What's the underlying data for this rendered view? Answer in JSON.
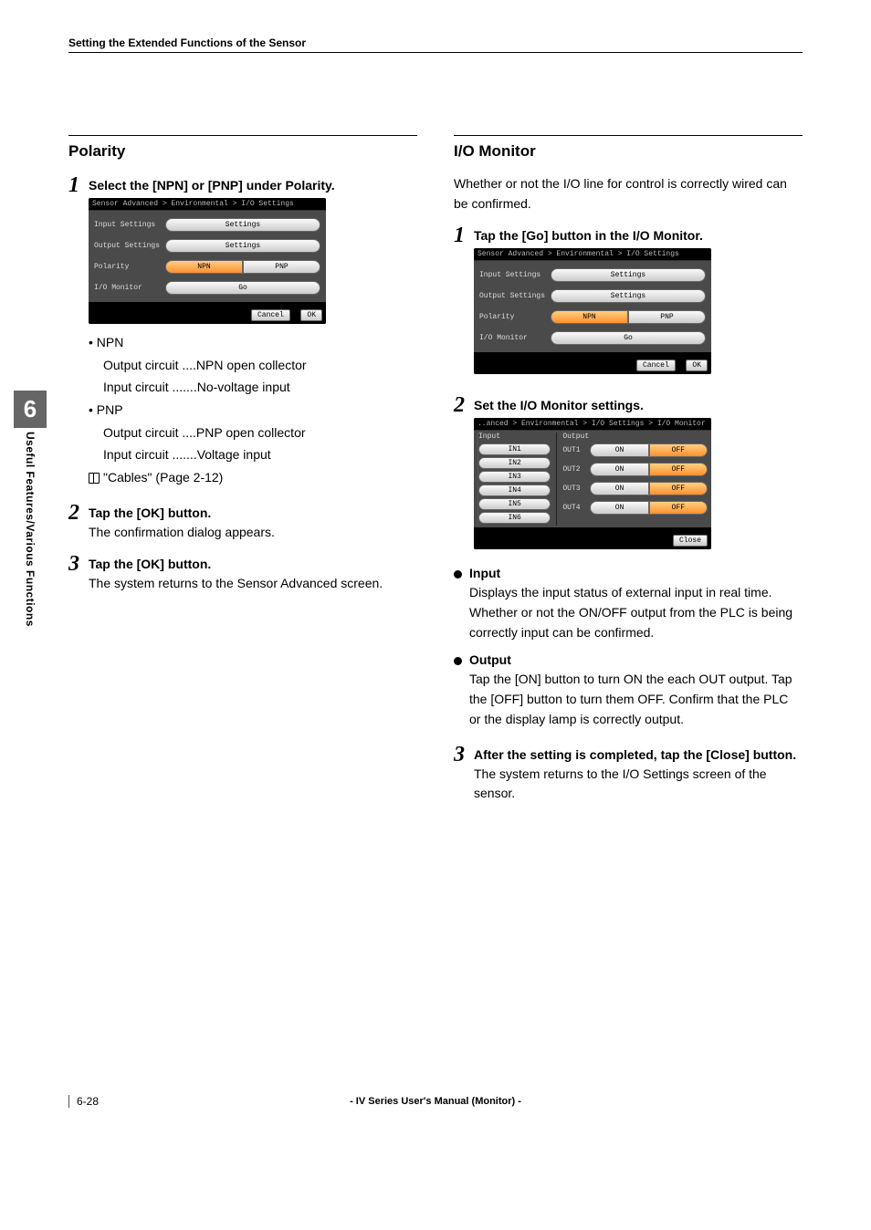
{
  "header": "Setting the Extended Functions of the Sensor",
  "chapter": {
    "num": "6",
    "label": "Useful Features/Various Functions"
  },
  "left": {
    "title": "Polarity",
    "s1": {
      "title": "Select the [NPN] or [PNP] under Polarity.",
      "npn_head": "NPN",
      "npn_l1": "Output circuit ....NPN open collector",
      "npn_l2": "Input circuit .......No-voltage input",
      "pnp_head": "PNP",
      "pnp_l1": "Output circuit ....PNP open collector",
      "pnp_l2": "Input circuit .......Voltage input",
      "ref": "\"Cables\" (Page 2-12)"
    },
    "s2": {
      "title": "Tap the [OK] button.",
      "text": "The confirmation dialog appears."
    },
    "s3": {
      "title": "Tap the [OK] button.",
      "text": "The system returns to the Sensor Advanced screen."
    }
  },
  "right": {
    "title": "I/O Monitor",
    "intro": "Whether or not the I/O line for control is correctly wired can be confirmed.",
    "s1": {
      "title": "Tap the [Go] button in the I/O Monitor."
    },
    "s2": {
      "title": "Set the I/O Monitor settings."
    },
    "input_title": "Input",
    "input_text": "Displays the input status of external input in real time. Whether or not the ON/OFF output from the PLC is being correctly input can be confirmed.",
    "output_title": "Output",
    "output_text": "Tap the [ON] button to turn ON the each OUT output. Tap the [OFF] button to turn them OFF. Confirm that the PLC or the display lamp is correctly output.",
    "s3": {
      "title": "After the setting is completed, tap the [Close] button.",
      "text": "The system returns to the I/O Settings screen of the sensor."
    }
  },
  "dev": {
    "breadcrumb": "Sensor Advanced > Environmental > I/O Settings",
    "row1": "Input Settings",
    "row2": "Output Settings",
    "row3": "Polarity",
    "row4": "I/O Monitor",
    "settings": "Settings",
    "npn": "NPN",
    "pnp": "PNP",
    "go": "Go",
    "cancel": "Cancel",
    "ok": "OK"
  },
  "iomon": {
    "breadcrumb": "..anced > Environmental > I/O Settings > I/O Monitor",
    "input": "Input",
    "output": "Output",
    "in": [
      "IN1",
      "IN2",
      "IN3",
      "IN4",
      "IN5",
      "IN6"
    ],
    "out": [
      "OUT1",
      "OUT2",
      "OUT3",
      "OUT4"
    ],
    "on": "ON",
    "off": "OFF",
    "close": "Close"
  },
  "footer": {
    "page": "6-28",
    "center": "- IV Series User's Manual (Monitor) -"
  }
}
